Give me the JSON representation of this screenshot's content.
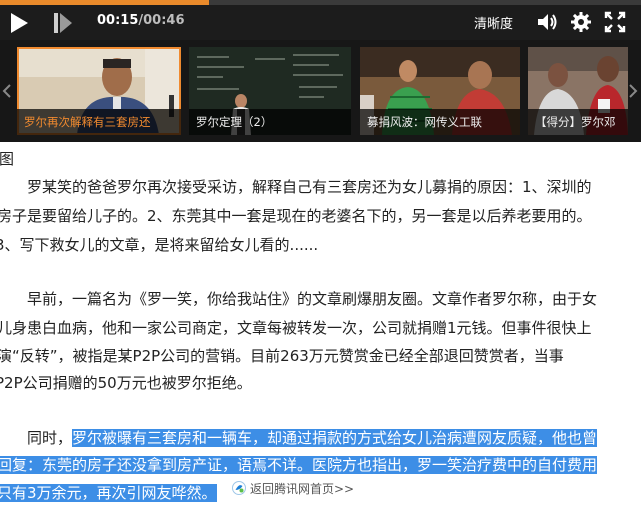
{
  "player": {
    "time_current": "00:15",
    "time_sep": "/",
    "time_total": "00:46",
    "progress_fraction": 0.326,
    "quality_label": "清晰度",
    "accent_color": "#e98a2b",
    "icons": [
      "play-icon",
      "next-icon",
      "volume-icon",
      "settings-gear-icon",
      "fullscreen-icon"
    ]
  },
  "thumbs": [
    {
      "caption": "罗尔再次解释有三套房还",
      "active": true
    },
    {
      "caption": "罗尔定理（2）",
      "active": false
    },
    {
      "caption": "募捐风波：网传义工联",
      "active": false
    },
    {
      "caption": "【得分】罗尔邓",
      "active": false
    }
  ],
  "article": {
    "caption_char": "图",
    "lines": [
      "　　罗某笑的爸爸罗尔再次接受采访，解释自己有三套房还为女儿募捐的原因：1、深圳的",
      "房子是要留给儿子的。2、东莞其中一套是现在的老婆名下的，另一套是以后养老要用的。",
      "3、写下救女儿的文章，是将来留给女儿看的......",
      "　　早前，一篇名为《罗一笑，你给我站住》的文章刷爆朋友圈。文章作者罗尔称，由于女",
      "儿身患白血病，他和一家公司商定，文章每被转发一次，公司就捐赠1元钱。但事件很快上",
      "演“反转”，被指是某P2P公司的营销。目前263万元赞赏金已经全部退回赞赏者，当事",
      "P2P公司捐赠的50万元也被罗尔拒绝。"
    ],
    "para3_prefix": "　　同时，",
    "para3_highlight_1": "罗尔被曝有三套房和一辆车，却通过捐款的方式给女儿治病遭网友质疑，他也曾",
    "para3_highlight_2": "回复：东莞的房子还没拿到房产证，语焉不详。医院方也指出，罗一笑治疗费中的自付费用",
    "para3_highlight_3": "只有3万余元，再次引网友哗然。",
    "highlight_color": "#3d8ee6"
  },
  "back_link": {
    "label": "返回腾讯网首页>>"
  }
}
